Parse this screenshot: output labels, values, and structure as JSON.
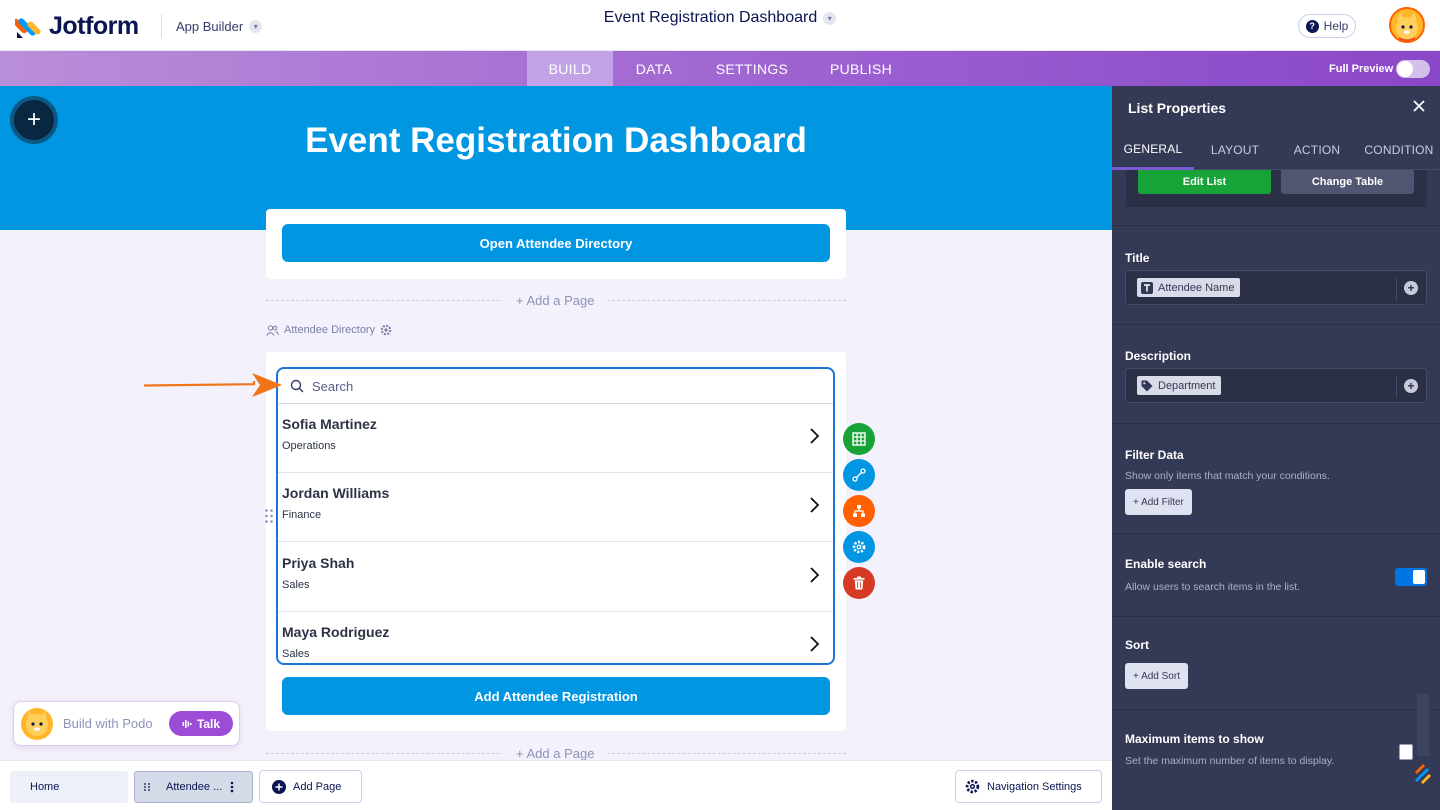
{
  "topbar": {
    "brand": "Jotform",
    "app_builder": "App Builder",
    "document_title": "Event Registration Dashboard",
    "help": "Help"
  },
  "nav": {
    "tabs": [
      {
        "label": "BUILD",
        "active": true
      },
      {
        "label": "DATA",
        "active": false
      },
      {
        "label": "SETTINGS",
        "active": false
      },
      {
        "label": "PUBLISH",
        "active": false
      }
    ],
    "full_preview": "Full Preview"
  },
  "canvas": {
    "hero_title": "Event Registration Dashboard",
    "open_directory_button": "Open Attendee Directory",
    "add_page": "+ Add a Page",
    "directory_label": "Attendee Directory",
    "search_placeholder": "Search",
    "list_items": [
      {
        "name": "Sofia Martinez",
        "department": "Operations"
      },
      {
        "name": "Jordan Williams",
        "department": "Finance"
      },
      {
        "name": "Priya Shah",
        "department": "Sales"
      },
      {
        "name": "Maya Rodriguez",
        "department": "Sales"
      }
    ],
    "add_registration_button": "Add Attendee Registration"
  },
  "podo": {
    "label": "Build with Podo",
    "talk": "Talk"
  },
  "bottombar": {
    "home": "Home",
    "current_page": "Attendee ...",
    "add_page": "Add Page",
    "navigation_settings": "Navigation Settings"
  },
  "panel": {
    "title": "List Properties",
    "tabs": [
      {
        "label": "GENERAL",
        "active": true
      },
      {
        "label": "LAYOUT",
        "active": false
      },
      {
        "label": "ACTION",
        "active": false
      },
      {
        "label": "CONDITION",
        "active": false
      }
    ],
    "edit_list": "Edit List",
    "change_table": "Change Table",
    "title_section": {
      "label": "Title",
      "tag": "Attendee Name"
    },
    "description_section": {
      "label": "Description",
      "tag": "Department"
    },
    "filter_section": {
      "label": "Filter Data",
      "desc": "Show only items that match your conditions.",
      "button": "+ Add Filter"
    },
    "search_section": {
      "label": "Enable search",
      "desc": "Allow users to search items in the list.",
      "enabled": true
    },
    "sort_section": {
      "label": "Sort",
      "button": "+ Add Sort"
    },
    "max_section": {
      "label": "Maximum items to show",
      "desc": "Set the maximum number of items to display.",
      "enabled": false
    }
  },
  "colors": {
    "hero_blue": "#0096e2",
    "nav_purple": "#9c5fd0",
    "panel_bg": "#343a55",
    "green": "#18a339",
    "delete_red": "#d63a25",
    "orange": "#ff6100"
  }
}
